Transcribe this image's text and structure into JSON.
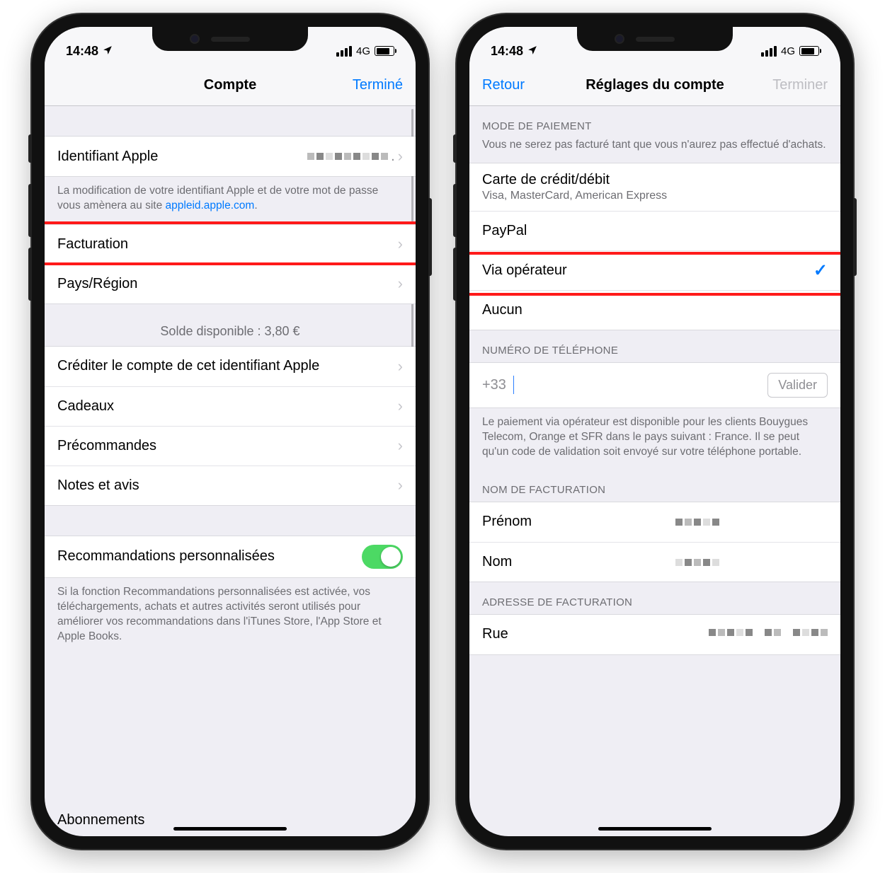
{
  "status": {
    "time": "14:48",
    "network": "4G"
  },
  "left": {
    "nav": {
      "title": "Compte",
      "done": "Terminé"
    },
    "apple_id_label": "Identifiant Apple",
    "apple_id_note_pre": "La modification de votre identifiant Apple et de votre mot de passe vous amènera au site ",
    "apple_id_link": "appleid.apple.com",
    "facturation": "Facturation",
    "pays_region": "Pays/Région",
    "solde": "Solde disponible : 3,80 €",
    "crediter": "Créditer le compte de cet identifiant Apple",
    "cadeaux": "Cadeaux",
    "precommandes": "Précommandes",
    "notes": "Notes et avis",
    "recos_label": "Recommandations personnalisées",
    "recos_note": "Si la fonction Recommandations personnalisées est activée, vos téléchargements, achats et autres activités seront utilisés pour améliorer vos recommandations dans l'iTunes Store, l'App Store et Apple Books.",
    "abonnements": "Abonnements"
  },
  "right": {
    "nav": {
      "back": "Retour",
      "title": "Réglages du compte",
      "done": "Terminer"
    },
    "mode_header": "MODE DE PAIEMENT",
    "mode_note": "Vous ne serez pas facturé tant que vous n'aurez pas effectué d'achats.",
    "cc_label": "Carte de crédit/débit",
    "cc_sub": "Visa, MasterCard, American Express",
    "paypal": "PayPal",
    "via_op": "Via opérateur",
    "aucun": "Aucun",
    "tel_header": "NUMÉRO DE TÉLÉPHONE",
    "tel_prefix": "+33",
    "valider": "Valider",
    "tel_note": "Le paiement via opérateur est disponible pour les clients Bouygues Telecom, Orange et SFR dans le pays suivant : France. Il se peut qu'un code de validation soit envoyé sur votre téléphone portable.",
    "fact_header": "NOM DE FACTURATION",
    "prenom": "Prénom",
    "nom": "Nom",
    "addr_header": "ADRESSE DE FACTURATION",
    "rue": "Rue"
  }
}
